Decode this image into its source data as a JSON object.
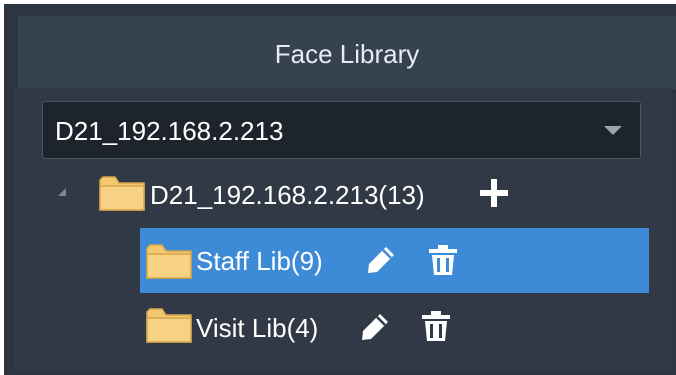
{
  "panel": {
    "title": "Face Library"
  },
  "device_select": {
    "value": "D21_192.168.2.213"
  },
  "tree": {
    "root": {
      "label": "D21_192.168.2.213(13)",
      "expanded": true,
      "icons": [
        "folder-icon",
        "add-icon"
      ]
    },
    "children": [
      {
        "label": "Staff Lib(9)",
        "selected": true,
        "icons": [
          "folder-icon",
          "edit-icon",
          "delete-icon"
        ]
      },
      {
        "label": "Visit Lib(4)",
        "selected": false,
        "icons": [
          "folder-icon",
          "edit-icon",
          "delete-icon"
        ]
      }
    ]
  },
  "colors": {
    "panel_bg": "#2c3541",
    "header_bg": "#36424f",
    "selection": "#3d8ad6",
    "folder": "#f2c56b",
    "text": "#ffffff"
  }
}
